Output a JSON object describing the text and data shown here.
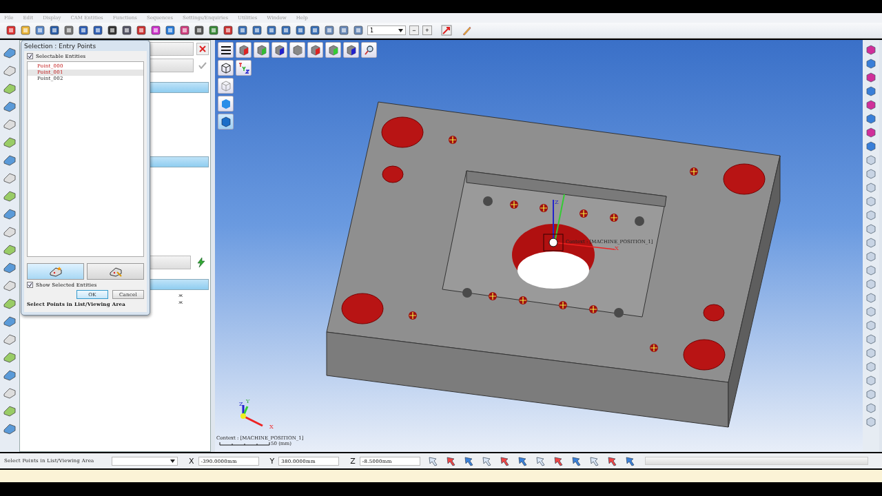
{
  "menu": [
    "File",
    "Edit",
    "Display",
    "CAM Entities",
    "Functions",
    "Sequences",
    "Settings/Enquiries",
    "Utilities",
    "Window",
    "Help"
  ],
  "toolbar": {
    "layer_value": "1",
    "minus": "−",
    "plus": "+"
  },
  "dialog": {
    "title": "Selection : Entry Points",
    "selectable": {
      "label": "Selectable Entities",
      "checked": true
    },
    "items": [
      {
        "label": "Point_000",
        "selected": true,
        "current": false
      },
      {
        "label": "Point_001",
        "selected": true,
        "current": true
      },
      {
        "label": "Point_002",
        "selected": false,
        "current": false
      }
    ],
    "show_selected": {
      "label": "Show Selected Entities",
      "checked": true
    },
    "buttons": [
      "OK",
      "Cancel"
    ],
    "prompt": "Select Points in List/Viewing Area"
  },
  "panel": {
    "marks": [
      "ж",
      "ж"
    ]
  },
  "viewport": {
    "context_label": "Context : [MACHINE_POSITION_1]",
    "part_axes": [
      "Z",
      "X"
    ],
    "triad_axes": [
      "Z",
      "Y",
      "X"
    ],
    "corner_context": "Context : [MACHINE_POSITION_1]",
    "scale": "50 (mm)"
  },
  "status_bar": {
    "prompt": "Select Points in List/Viewing Area",
    "coords": [
      {
        "axis": "X",
        "value": "-390.0000mm"
      },
      {
        "axis": "Y",
        "value": "380.0000mm"
      },
      {
        "axis": "Z",
        "value": "-8.5000mm"
      }
    ]
  }
}
